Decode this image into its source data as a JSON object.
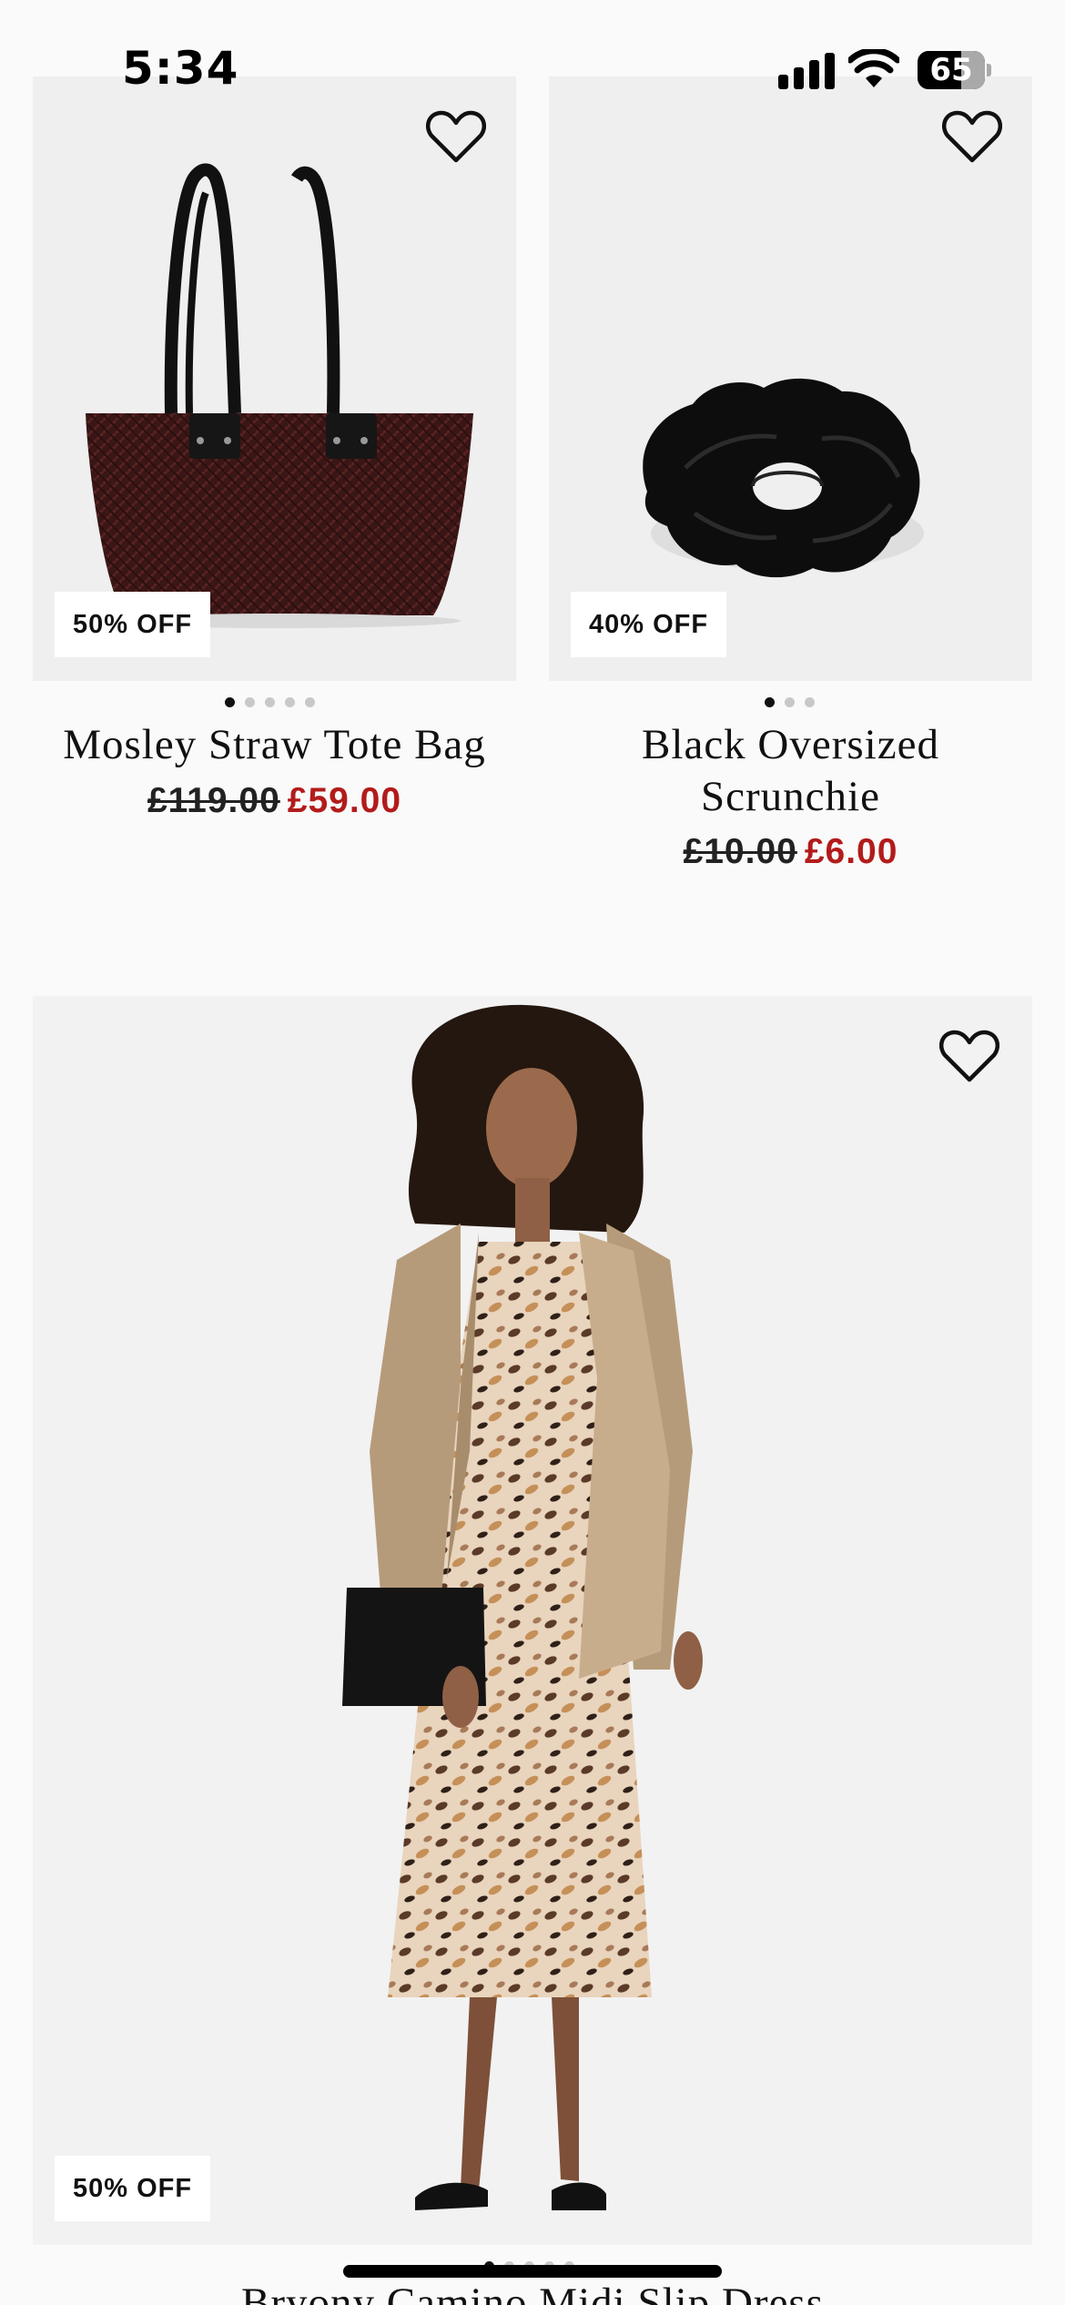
{
  "status_bar": {
    "time": "5:34",
    "battery_level": "65",
    "battery_fraction": 0.65
  },
  "products": [
    {
      "name": "Mosley Straw Tote Bag",
      "original_price": "£119.00",
      "sale_price": "£59.00",
      "badge": "50% OFF",
      "image_count": 5,
      "active_image": 0
    },
    {
      "name_lines": [
        "Black Oversized",
        "Scrunchie"
      ],
      "original_price": "£10.00",
      "sale_price": "£6.00",
      "badge": "40% OFF",
      "image_count": 3,
      "active_image": 0
    },
    {
      "name": "Bryony Camino Midi Slip Dress",
      "badge": "50% OFF",
      "image_count": 5,
      "active_image": 0
    }
  ],
  "colors": {
    "sale_price": "#b31b1b",
    "image_background": "#efefef",
    "page_background": "#fafafa"
  },
  "icons": {
    "favourite": "heart-outline-icon"
  }
}
